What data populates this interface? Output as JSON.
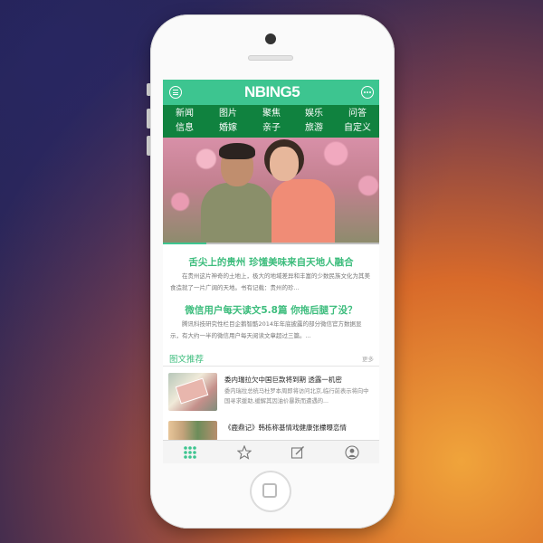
{
  "app": {
    "logo_text": "NBING5",
    "accent_color": "#3dc590",
    "nav_color": "#10823f",
    "header_icons": [
      "menu-icon",
      "chat-icon"
    ]
  },
  "categories": [
    "新闻",
    "图片",
    "聚焦",
    "娱乐",
    "问答",
    "信息",
    "婚嫁",
    "亲子",
    "旅游",
    "自定义"
  ],
  "hero": {
    "image": "couple-photo",
    "slide_progress": 0.2
  },
  "news": [
    {
      "title": "舌尖上的贵州 珍馐美味来自天地人融合",
      "desc": "在贵州这片神奇的土地上，极大的地域差异和丰富的少数民族文化为其美食造就了一片广阔的天地。书有记载：贵州的珍..."
    },
    {
      "title": "微信用户每天读文5.8篇 你拖后腿了没？",
      "desc": "腾讯科技研究性栏目企鹅智酷2014年年底披露的部分微信官方数据显示，有大约一半的微信用户每天阅读文章超过三篇。..."
    }
  ],
  "section": {
    "title": "图文推荐",
    "more": "更多"
  },
  "recommend": [
    {
      "title": "委内瑞拉欠中国巨款将到期 透露一机密",
      "desc": "委内瑞拉总统马杜罗本周即将访问北京,临行前表示将向中国寻求援助,缓解其因油价暴跌而遭遇的..."
    },
    {
      "title": "《鹿鼎记》韩栋称基情戏健康张檬曝恋情",
      "desc": ""
    }
  ],
  "tabbar": {
    "tabs": [
      "grid-icon",
      "star-icon",
      "edit-icon",
      "user-icon"
    ],
    "active": "grid-icon"
  }
}
